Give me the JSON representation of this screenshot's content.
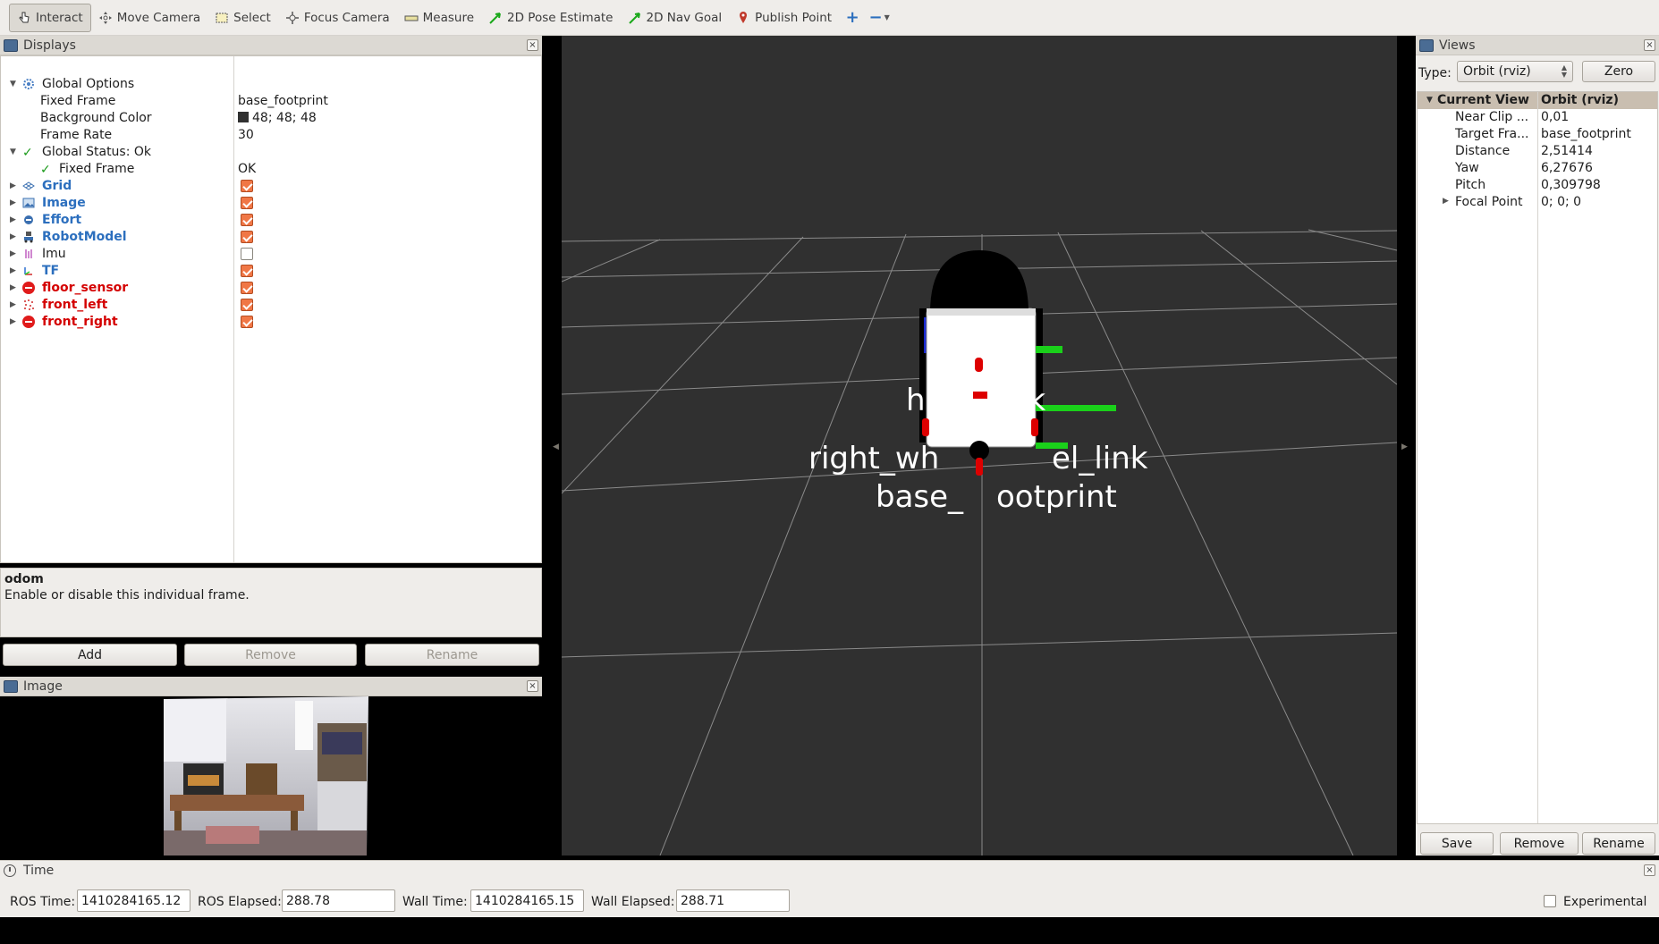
{
  "toolbar": {
    "tools": [
      {
        "label": "Interact",
        "icon": "hand-cursor-icon",
        "active": true
      },
      {
        "label": "Move Camera",
        "icon": "move-arrows-icon"
      },
      {
        "label": "Select",
        "icon": "select-box-icon"
      },
      {
        "label": "Focus Camera",
        "icon": "focus-target-icon"
      },
      {
        "label": "Measure",
        "icon": "ruler-icon"
      },
      {
        "label": "2D Pose Estimate",
        "icon": "green-arrow-icon"
      },
      {
        "label": "2D Nav Goal",
        "icon": "green-arrow-icon"
      },
      {
        "label": "Publish Point",
        "icon": "map-pin-icon"
      }
    ],
    "add_tool": "+",
    "remove_tool": "−"
  },
  "displays": {
    "title": "Displays",
    "rows": [
      {
        "label": "Global Options",
        "value": ""
      },
      {
        "label": "Fixed Frame",
        "value": "base_footprint"
      },
      {
        "label": "Background Color",
        "value": "48; 48; 48"
      },
      {
        "label": "Frame Rate",
        "value": "30"
      },
      {
        "label": "Global Status: Ok",
        "value": ""
      },
      {
        "label": "Fixed Frame",
        "value": "OK"
      },
      {
        "label": "Grid",
        "checked": true
      },
      {
        "label": "Image",
        "checked": true
      },
      {
        "label": "Effort",
        "checked": true
      },
      {
        "label": "RobotModel",
        "checked": true
      },
      {
        "label": "Imu",
        "checked": false
      },
      {
        "label": "TF",
        "checked": true
      },
      {
        "label": "floor_sensor",
        "checked": true
      },
      {
        "label": "front_left",
        "checked": true
      },
      {
        "label": "front_right",
        "checked": true
      }
    ],
    "background_color": "#303030"
  },
  "description": {
    "title": "odom",
    "text": "Enable or disable this individual frame."
  },
  "buttons": {
    "add": "Add",
    "remove": "Remove",
    "rename": "Rename"
  },
  "image_panel": {
    "title": "Image"
  },
  "scene": {
    "labels": {
      "head": "h",
      "head_suffix": "nk",
      "right_wheel": "right_wh",
      "left_wheel": "el_link",
      "base": "base_",
      "base_suffix": "ootprint"
    }
  },
  "views": {
    "title": "Views",
    "type_label": "Type:",
    "type_value": "Orbit (rviz)",
    "zero_label": "Zero",
    "header": {
      "name": "Current View",
      "value": "Orbit (rviz)"
    },
    "rows": [
      {
        "label": "Near Clip ...",
        "value": "0,01"
      },
      {
        "label": "Target Fra...",
        "value": "base_footprint"
      },
      {
        "label": "Distance",
        "value": "2,51414"
      },
      {
        "label": "Yaw",
        "value": "6,27676"
      },
      {
        "label": "Pitch",
        "value": "0,309798"
      },
      {
        "label": "Focal Point",
        "value": "0; 0; 0"
      }
    ],
    "save_label": "Save",
    "remove_label": "Remove",
    "rename_label": "Rename"
  },
  "time": {
    "title": "Time",
    "ros_time_label": "ROS Time:",
    "ros_time": "1410284165.12",
    "ros_elapsed_label": "ROS Elapsed:",
    "ros_elapsed": "288.78",
    "wall_time_label": "Wall Time:",
    "wall_time": "1410284165.15",
    "wall_elapsed_label": "Wall Elapsed:",
    "wall_elapsed": "288.71",
    "experimental_label": "Experimental",
    "experimental_checked": false
  }
}
